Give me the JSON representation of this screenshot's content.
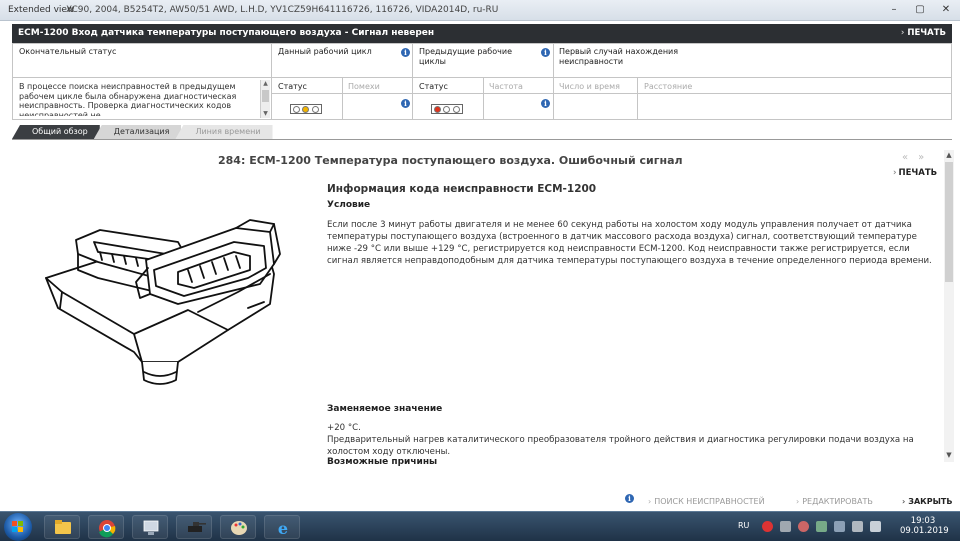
{
  "window": {
    "mode": "Extended view",
    "vehicle": "XC90, 2004, B5254T2, AW50/51 AWD, L.H.D, YV1CZ59H641116726, 116726, VIDA2014D, ru-RU",
    "controls": [
      "–",
      "▢",
      "✕"
    ]
  },
  "header": {
    "title": "ECM-1200 Вход датчика температуры поступающего воздуха - Сигнал неверен",
    "print_label": "ПЕЧАТЬ"
  },
  "status_grid": {
    "final_status_label": "Окончательный статус",
    "final_status_text": "В процессе поиска неисправностей в предыдущем рабочем цикле была обнаружена диагностическая неисправность. Проверка диагностических кодов неисправностей не",
    "current_cycle_label": "Данный рабочий цикл",
    "current_status_label": "Статус",
    "current_interference_label": "Помехи",
    "previous_cycles_label": "Предыдущие рабочие циклы",
    "previous_status_label": "Статус",
    "previous_frequency_label": "Частота",
    "first_occurrence_label": "Первый случай нахождения неисправности",
    "date_time_label": "Число и время",
    "distance_label": "Расстояние",
    "current_lights": [
      "#ffffff",
      "#f2b400",
      "#ffffff"
    ],
    "previous_lights": [
      "#e0321c",
      "#ffffff",
      "#ffffff"
    ]
  },
  "tabs": [
    {
      "label": "Общий обзор",
      "state": "active"
    },
    {
      "label": "Детализация",
      "state": "inactive"
    },
    {
      "label": "Линия времени",
      "state": "disabled"
    }
  ],
  "content": {
    "title": "284: ECM-1200 Температура поступающего воздуха. Ошибочный сигнал",
    "print_label": "ПЕЧАТЬ",
    "section_title": "Информация кода неисправности ECM-1200",
    "condition_heading": "Условие",
    "condition_text": "Если после 3 минут работы двигателя и не менее 60 секунд работы на холостом ходу модуль управления получает от датчика температуры поступающего воздуха (встроенного в датчик массового расхода воздуха) сигнал, соответствующий температуре ниже -29 °C или выше +129 °C, регистрируется код неисправности ECM-1200. Код неисправности также регистрируется, если сигнал является неправдоподобным для датчика температуры поступающего воздуха в течение определенного периода времени.",
    "replacement_heading": "Заменяемое значение",
    "replacement_value": "+20 °C.",
    "replacement_text": "Предварительный нагрев каталитического преобразователя тройного действия и диагностика регулировки подачи воздуха на холостом ходу отключены.",
    "causes_heading": "Возможные причины"
  },
  "footer": {
    "troubleshoot_label": "ПОИСК НЕИСПРАВНОСТЕЙ",
    "edit_label": "РЕДАКТИРОВАТЬ",
    "close_label": "ЗАКРЫТЬ"
  },
  "taskbar": {
    "language": "RU",
    "time": "19:03",
    "date": "09.01.2019"
  }
}
